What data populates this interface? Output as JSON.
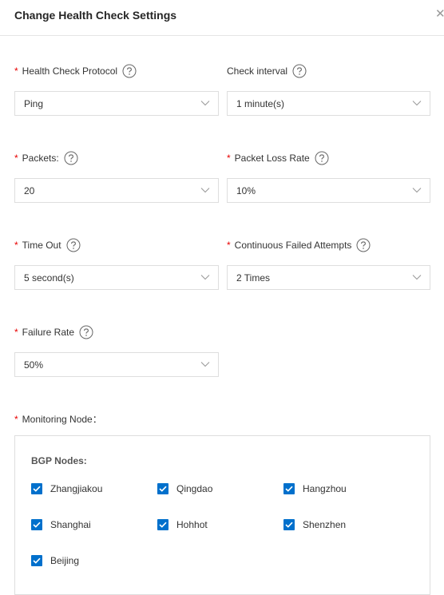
{
  "dialog": {
    "title": "Change Health Check Settings"
  },
  "required_mark": "*",
  "fields": {
    "protocol": {
      "label": "Health Check Protocol",
      "value": "Ping"
    },
    "interval": {
      "label": "Check interval",
      "value": "1 minute(s)"
    },
    "packets": {
      "label": "Packets:",
      "value": "20"
    },
    "loss_rate": {
      "label": "Packet Loss Rate",
      "value": "10%"
    },
    "timeout": {
      "label": "Time Out",
      "value": "5 second(s)"
    },
    "failed_attempts": {
      "label": "Continuous Failed Attempts",
      "value": "2 Times"
    },
    "failure_rate": {
      "label": "Failure Rate",
      "value": "50%"
    }
  },
  "monitoring": {
    "label": "Monitoring Node：",
    "group_title": "BGP Nodes:",
    "nodes": [
      {
        "label": "Zhangjiakou",
        "checked": true
      },
      {
        "label": "Qingdao",
        "checked": true
      },
      {
        "label": "Hangzhou",
        "checked": true
      },
      {
        "label": "Shanghai",
        "checked": true
      },
      {
        "label": "Hohhot",
        "checked": true
      },
      {
        "label": "Shenzhen",
        "checked": true
      },
      {
        "label": "Beijing",
        "checked": true
      }
    ]
  },
  "colors": {
    "accent": "#0070cc",
    "required": "#e80000",
    "border": "#dedede"
  },
  "icons": {
    "help": "question-circle-icon",
    "dropdown": "chevron-down-icon",
    "close": "close-icon",
    "check": "checkmark-icon"
  }
}
